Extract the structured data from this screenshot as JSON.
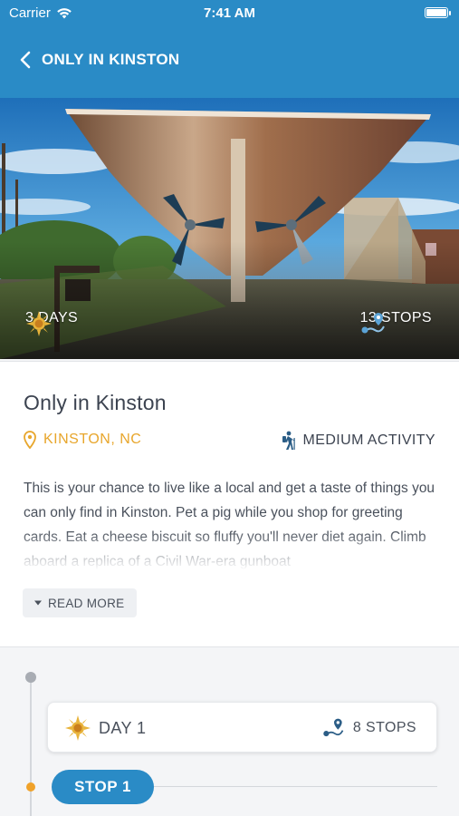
{
  "status_bar": {
    "carrier": "Carrier",
    "time": "7:41 AM",
    "icons": [
      "wifi-icon",
      "battery-icon"
    ]
  },
  "header": {
    "title": "ONLY IN KINSTON",
    "back_icon": "chevron-left-icon",
    "background_color": "#2a8bc6"
  },
  "hero": {
    "days_label": "3 DAYS",
    "days_icon": "sun-icon",
    "stops_label": "13 STOPS",
    "stops_icon": "route-icon"
  },
  "tour": {
    "title": "Only in Kinston",
    "location": "KINSTON, NC",
    "location_icon": "map-pin-icon",
    "location_color": "#e8a62c",
    "activity": "MEDIUM ACTIVITY",
    "activity_icon": "hiker-icon",
    "description": "This is your chance to live like a local and get a taste of things you can only find in Kinston. Pet a pig while you shop for greeting cards. Eat a cheese biscuit so fluffy you'll never diet again. Climb aboard a replica of a Civil War-era gunboat",
    "read_more": "READ MORE"
  },
  "itinerary": {
    "day_label": "DAY 1",
    "day_stops": "8 STOPS",
    "stop_label": "STOP 1",
    "accent_color": "#2a8bc6",
    "stop_dot_color": "#f0a22a"
  }
}
